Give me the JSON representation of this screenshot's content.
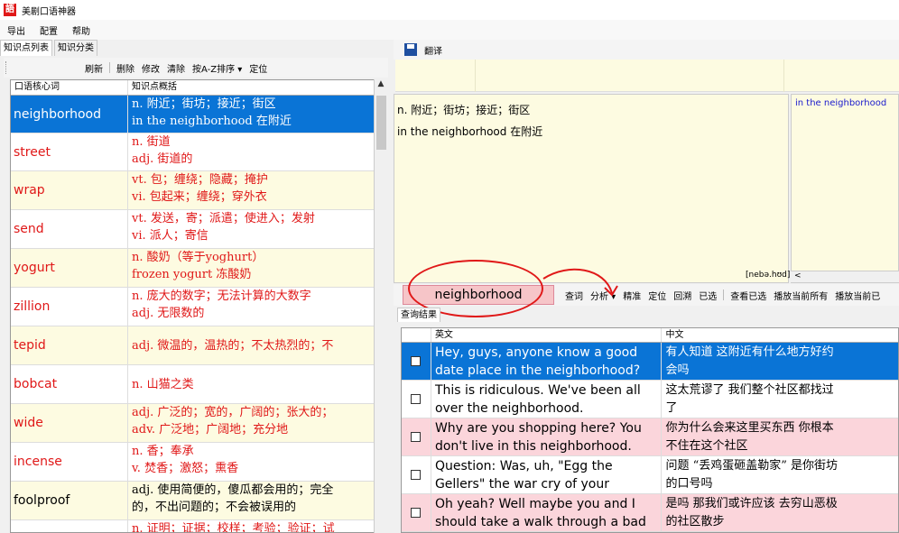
{
  "window": {
    "title": "美剧口语神器"
  },
  "menu": [
    "导出",
    "配置",
    "帮助"
  ],
  "left": {
    "tabs": [
      "知识点列表",
      "知识分类"
    ],
    "toolbar": [
      "刷新",
      "删除",
      "修改",
      "清除",
      "按A-Z排序 ▾",
      "定位"
    ],
    "columns": [
      "口语核心词",
      "知识点概括"
    ],
    "rows": [
      {
        "word": "neighborhood",
        "lines": [
          "n. 附近；街坊；接近；街区",
          "in the neighborhood 在附近"
        ]
      },
      {
        "word": "street",
        "lines": [
          "n. 街道",
          "adj. 街道的"
        ]
      },
      {
        "word": "wrap",
        "lines": [
          "vt. 包；缠绕；隐藏；掩护",
          "vi. 包起来；缠绕；穿外衣"
        ]
      },
      {
        "word": "send",
        "lines": [
          "vt. 发送，寄；派遣；使进入；发射",
          "vi. 派人；寄信"
        ]
      },
      {
        "word": "yogurt",
        "lines": [
          "n. 酸奶（等于yoghurt）",
          "frozen yogurt 冻酸奶"
        ]
      },
      {
        "word": "zillion",
        "lines": [
          "n. 庞大的数字；无法计算的大数字",
          "adj. 无限数的"
        ]
      },
      {
        "word": "tepid",
        "lines": [
          "adj. 微温的，温热的；不太热烈的；不"
        ]
      },
      {
        "word": "bobcat",
        "lines": [
          "n. 山猫之类"
        ]
      },
      {
        "word": "wide",
        "lines": [
          "adj. 广泛的；宽的，广阔的；张大的；",
          "adv. 广泛地；广阔地；充分地"
        ]
      },
      {
        "word": "incense",
        "lines": [
          "n. 香；奉承",
          "v. 焚香；激怒；熏香"
        ]
      },
      {
        "word": "foolproof",
        "lines": [
          "adj. 使用简便的，傻瓜都会用的；完全",
          "的，不出问题的；不会被误用的"
        ]
      },
      {
        "word": "",
        "lines": [
          "n. 证明；证据；校样；考验；验证；试"
        ]
      }
    ]
  },
  "right": {
    "toolbar_label": "翻译",
    "definition_lines": [
      "n. 附近；街坊；接近；街区",
      "in the neighborhood 在附近"
    ],
    "side_text": "in the neighborhood",
    "phonetic": "[nebə.hʊd]",
    "query": "neighborhood",
    "query_buttons": [
      "查词",
      "分析 ▾",
      "精准",
      "定位",
      "回溯",
      "已选",
      "查看已选",
      "播放当前所有",
      "播放当前已"
    ],
    "result_tab": "查询结果",
    "columns": [
      "英文",
      "中文"
    ],
    "rows": [
      {
        "en": "Hey, guys, anyone know a good date place in the neighborhood?",
        "zh": [
          "有人知道 这附近有什么地方好约",
          "会吗"
        ]
      },
      {
        "en": "This is ridiculous. We've been all over the neighborhood.",
        "zh": [
          "这太荒谬了 我们整个社区都找过",
          "了"
        ]
      },
      {
        "en": "Why are you shopping here? You don't live in this neighborhood.",
        "zh": [
          "你为什么会来这里买东西 你根本",
          "不住在这个社区"
        ]
      },
      {
        "en": "Question: Was, uh, \"Egg the Gellers\" the war cry of your",
        "zh": [
          "问题 “丢鸡蛋砸盖勒家” 是你街坊",
          "的口号吗"
        ]
      },
      {
        "en": "Oh yeah? Well maybe you and I should take a walk through a bad",
        "zh": [
          "是吗 那我们或许应该 去穷山恶极",
          "的社区散步"
        ]
      }
    ]
  }
}
